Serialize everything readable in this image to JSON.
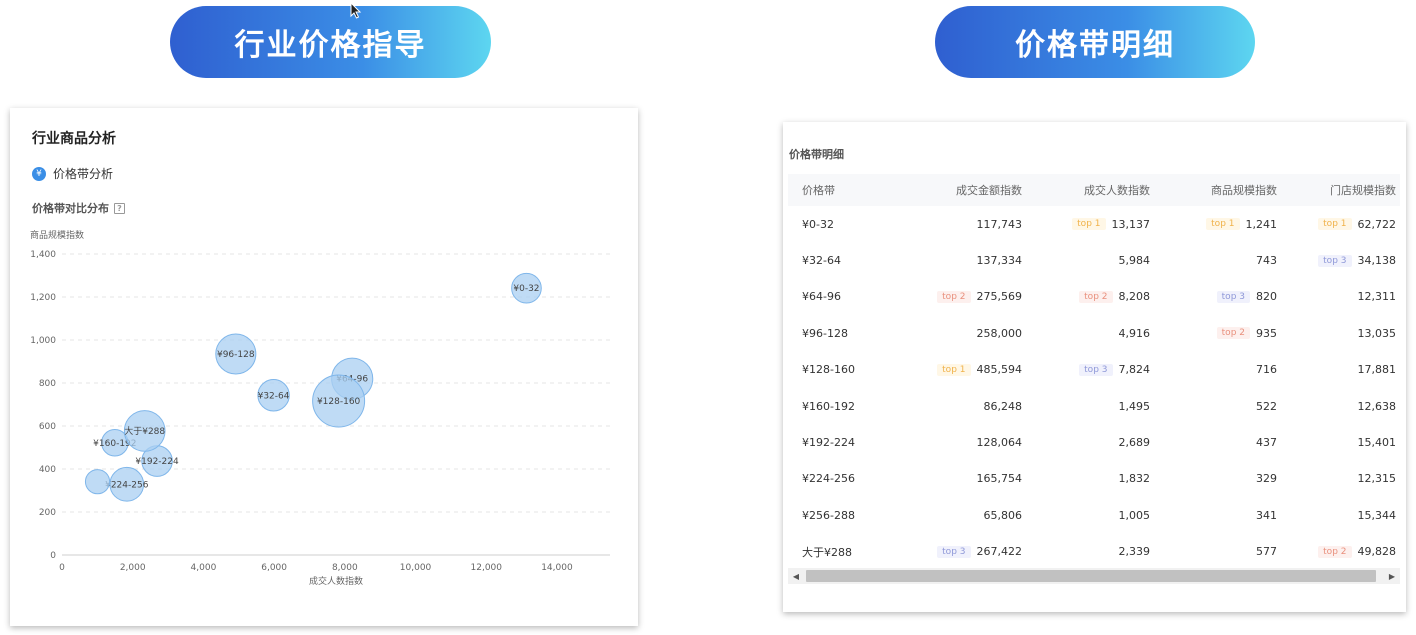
{
  "pills": {
    "left": "行业价格指导",
    "right": "价格带明细"
  },
  "left_card": {
    "title": "行业商品分析",
    "sub_icon": "¥",
    "sub_label": "价格带分析",
    "chart_title": "价格带对比分布",
    "help": "?"
  },
  "chart_data": {
    "type": "scatter",
    "xlabel": "成交人数指数",
    "ylabel": "商品规模指数",
    "xlim": [
      0,
      15500
    ],
    "ylim": [
      0,
      1400
    ],
    "xticks": [
      0,
      2000,
      4000,
      6000,
      8000,
      10000,
      12000,
      14000
    ],
    "xtick_labels": [
      "0",
      "2,000",
      "4,000",
      "6,000",
      "8,000",
      "10,000",
      "12,000",
      "14,000"
    ],
    "yticks": [
      0,
      200,
      400,
      600,
      800,
      1000,
      1200,
      1400
    ],
    "ytick_labels": [
      "0",
      "200",
      "400",
      "600",
      "800",
      "1,000",
      "1,200",
      "1,400"
    ],
    "grid": true,
    "color": "#a9cff1",
    "points": [
      {
        "label": "¥0-32",
        "x": 13137,
        "y": 1241,
        "size": 117743
      },
      {
        "label": "¥32-64",
        "x": 5984,
        "y": 743,
        "size": 137334
      },
      {
        "label": "¥64-96",
        "x": 8208,
        "y": 820,
        "size": 275569
      },
      {
        "label": "¥96-128",
        "x": 4916,
        "y": 935,
        "size": 258000
      },
      {
        "label": "¥128-160",
        "x": 7824,
        "y": 716,
        "size": 485594
      },
      {
        "label": "¥160-192",
        "x": 1495,
        "y": 522,
        "size": 86248
      },
      {
        "label": "¥192-224",
        "x": 2689,
        "y": 437,
        "size": 128064
      },
      {
        "label": "¥224-256",
        "x": 1832,
        "y": 329,
        "size": 165754
      },
      {
        "label": "",
        "x": 1005,
        "y": 341,
        "size": 65806
      },
      {
        "label": "大于¥288",
        "x": 2339,
        "y": 577,
        "size": 267422
      }
    ]
  },
  "right_card": {
    "title": "价格带明细",
    "columns": [
      "价格带",
      "成交金额指数",
      "成交人数指数",
      "商品规模指数",
      "门店规模指数"
    ],
    "rows": [
      {
        "band": "¥0-32",
        "amount": "117,743",
        "amount_tag": "",
        "people": "13,137",
        "people_tag": "top 1",
        "goods": "1,241",
        "goods_tag": "top 1",
        "stores": "62,722",
        "stores_tag": "top 1"
      },
      {
        "band": "¥32-64",
        "amount": "137,334",
        "amount_tag": "",
        "people": "5,984",
        "people_tag": "",
        "goods": "743",
        "goods_tag": "",
        "stores": "34,138",
        "stores_tag": "top 3"
      },
      {
        "band": "¥64-96",
        "amount": "275,569",
        "amount_tag": "top 2",
        "people": "8,208",
        "people_tag": "top 2",
        "goods": "820",
        "goods_tag": "top 3",
        "stores": "12,311",
        "stores_tag": ""
      },
      {
        "band": "¥96-128",
        "amount": "258,000",
        "amount_tag": "",
        "people": "4,916",
        "people_tag": "",
        "goods": "935",
        "goods_tag": "top 2",
        "stores": "13,035",
        "stores_tag": ""
      },
      {
        "band": "¥128-160",
        "amount": "485,594",
        "amount_tag": "top 1",
        "people": "7,824",
        "people_tag": "top 3",
        "goods": "716",
        "goods_tag": "",
        "stores": "17,881",
        "stores_tag": ""
      },
      {
        "band": "¥160-192",
        "amount": "86,248",
        "amount_tag": "",
        "people": "1,495",
        "people_tag": "",
        "goods": "522",
        "goods_tag": "",
        "stores": "12,638",
        "stores_tag": ""
      },
      {
        "band": "¥192-224",
        "amount": "128,064",
        "amount_tag": "",
        "people": "2,689",
        "people_tag": "",
        "goods": "437",
        "goods_tag": "",
        "stores": "15,401",
        "stores_tag": ""
      },
      {
        "band": "¥224-256",
        "amount": "165,754",
        "amount_tag": "",
        "people": "1,832",
        "people_tag": "",
        "goods": "329",
        "goods_tag": "",
        "stores": "12,315",
        "stores_tag": ""
      },
      {
        "band": "¥256-288",
        "amount": "65,806",
        "amount_tag": "",
        "people": "1,005",
        "people_tag": "",
        "goods": "341",
        "goods_tag": "",
        "stores": "15,344",
        "stores_tag": ""
      },
      {
        "band": "大于¥288",
        "amount": "267,422",
        "amount_tag": "top 3",
        "people": "2,339",
        "people_tag": "",
        "goods": "577",
        "goods_tag": "",
        "stores": "49,828",
        "stores_tag": "top 2"
      }
    ],
    "scroll_left": "◀",
    "scroll_right": "▶"
  }
}
